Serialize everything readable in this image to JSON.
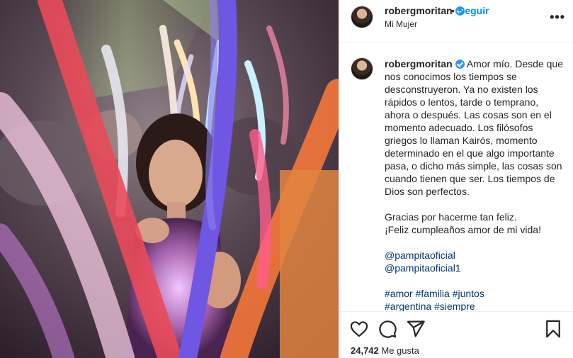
{
  "header": {
    "username": "robergmoritan",
    "separator": "•",
    "follow_label": "Seguir",
    "location": "Mi Mujer",
    "more_label": "•••"
  },
  "caption": {
    "username": "robergmoritan",
    "paragraph1": "Amor mío. Desde que nos conocimos los tiempos se desconstruyeron. Ya no existen los rápidos o lentos, tarde o temprano, ahora o después. Las cosas son en el momento adecuado. Los filósofos griegos lo llaman Kairós, momento determinado en el que algo importante pasa, o dicho más simple, las cosas son cuando tienen que ser. Los tiempos de Dios son perfectos.",
    "line_gracias": "Gracias por hacerme tan feliz.",
    "line_feliz": "¡Feliz cumpleaños amor de mi vida!",
    "mention1": "@pampitaoficial",
    "mention2": "@pampitaoficial1",
    "tag_amor": "#amor",
    "tag_familia": "#familia",
    "tag_juntos": "#juntos",
    "tag_argentina": "#argentina",
    "tag_siempre": "#siempre"
  },
  "actions": {
    "like_icon": "heart-icon",
    "comment_icon": "comment-icon",
    "share_icon": "paper-plane-icon",
    "save_icon": "bookmark-icon",
    "likes_count": "24,742",
    "likes_label": "Me gusta"
  },
  "colors": {
    "link": "#00376b",
    "follow": "#0095f6",
    "verified": "#3897f0"
  }
}
